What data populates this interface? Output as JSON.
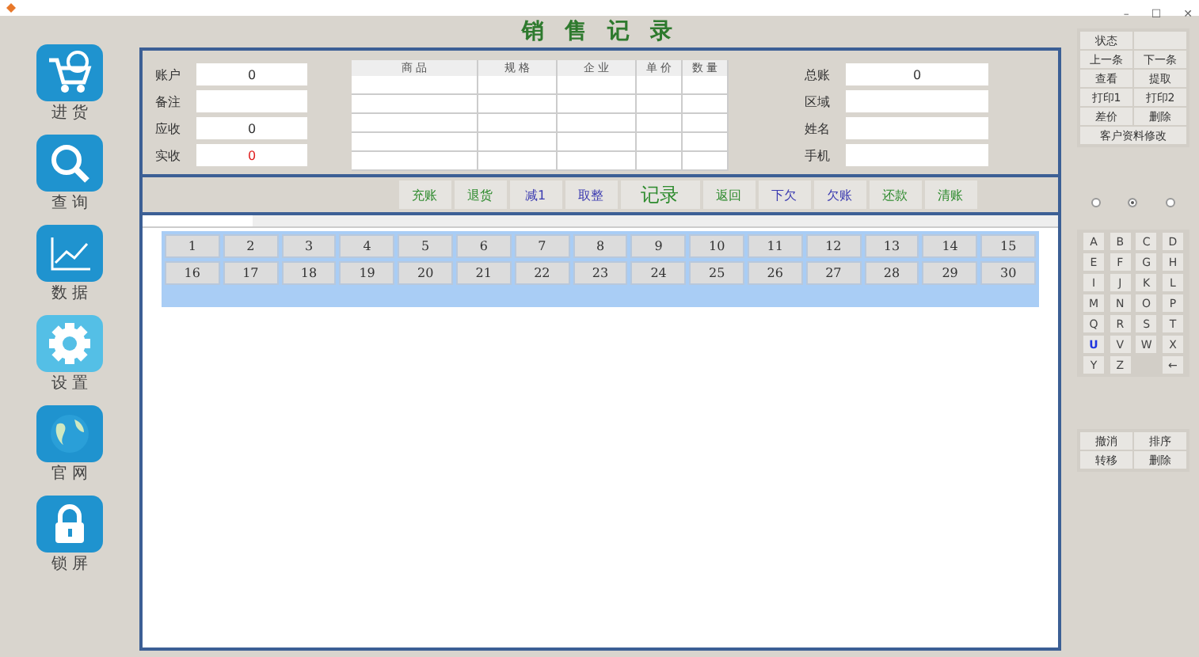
{
  "window": {
    "controls": [
      "–",
      "☐",
      "✕"
    ]
  },
  "title": "销 售 记 录",
  "sidebar": [
    {
      "label": "进 货",
      "kind": "cart"
    },
    {
      "label": "查 询",
      "kind": "search"
    },
    {
      "label": "数 据",
      "kind": "chart"
    },
    {
      "label": "设 置",
      "kind": "gear"
    },
    {
      "label": "官 网",
      "kind": "globe"
    },
    {
      "label": "锁 屏",
      "kind": "lock"
    }
  ],
  "left_fields": [
    {
      "label": "账户",
      "value": "0",
      "alert": false
    },
    {
      "label": "备注"
    },
    {
      "label": "应收",
      "value": "0",
      "alert": false
    },
    {
      "label": "实收",
      "value": "0",
      "alert": true
    }
  ],
  "table": {
    "columns": [
      "商 品",
      "规 格",
      "企 业",
      "单 价",
      "数 量"
    ]
  },
  "right_fields": [
    {
      "label": "总账",
      "value": "0"
    },
    {
      "label": "区域"
    },
    {
      "label": "姓名"
    },
    {
      "label": "手机"
    }
  ],
  "toolbar": [
    {
      "label": "充账",
      "color": "#2e8b2e",
      "big": false
    },
    {
      "label": "退货",
      "color": "#2e8b2e",
      "big": false
    },
    {
      "label": "减1",
      "color": "#3a3ab0",
      "big": false
    },
    {
      "label": "取整",
      "color": "#3a3ab0",
      "big": false
    },
    {
      "label": "记录",
      "color": "#2e8b2e",
      "big": true
    },
    {
      "label": "返回",
      "color": "#2e8b2e",
      "big": false
    },
    {
      "label": "下欠",
      "color": "#3a3ab0",
      "big": false
    },
    {
      "label": "欠账",
      "color": "#3a3ab0",
      "big": false
    },
    {
      "label": "还款",
      "color": "#2e8b2e",
      "big": false
    },
    {
      "label": "清账",
      "color": "#2e8b2e",
      "big": false
    }
  ],
  "numbers": [
    "1",
    "2",
    "3",
    "4",
    "5",
    "6",
    "7",
    "8",
    "9",
    "10",
    "11",
    "12",
    "13",
    "14",
    "15",
    "16",
    "17",
    "18",
    "19",
    "20",
    "21",
    "22",
    "23",
    "24",
    "25",
    "26",
    "27",
    "28",
    "29",
    "30"
  ],
  "side_buttons": [
    {
      "kind": "button",
      "label": "状态"
    },
    {
      "kind": "blank"
    },
    {
      "kind": "button",
      "label": "上一条"
    },
    {
      "kind": "button",
      "label": "下一条"
    },
    {
      "kind": "button",
      "label": "查看"
    },
    {
      "kind": "button",
      "label": "提取"
    },
    {
      "kind": "button",
      "label": "打印1"
    },
    {
      "kind": "button",
      "label": "打印2"
    },
    {
      "kind": "button",
      "label": "差价"
    },
    {
      "kind": "button",
      "label": "删除"
    },
    {
      "kind": "wide",
      "label": "客户资料修改"
    }
  ],
  "radios": [
    {
      "selected": false
    },
    {
      "selected": true
    },
    {
      "selected": false
    }
  ],
  "keys": [
    {
      "label": "A",
      "highlight": false
    },
    {
      "label": "B",
      "highlight": false
    },
    {
      "label": "C",
      "highlight": false
    },
    {
      "label": "D",
      "highlight": false
    },
    {
      "label": "E",
      "highlight": false
    },
    {
      "label": "F",
      "highlight": false
    },
    {
      "label": "G",
      "highlight": false
    },
    {
      "label": "H",
      "highlight": false
    },
    {
      "label": "I",
      "highlight": false
    },
    {
      "label": "J",
      "highlight": false
    },
    {
      "label": "K",
      "highlight": false
    },
    {
      "label": "L",
      "highlight": false
    },
    {
      "label": "M",
      "highlight": false
    },
    {
      "label": "N",
      "highlight": false
    },
    {
      "label": "O",
      "highlight": false
    },
    {
      "label": "P",
      "highlight": false
    },
    {
      "label": "Q",
      "highlight": false
    },
    {
      "label": "R",
      "highlight": false
    },
    {
      "label": "S",
      "highlight": false
    },
    {
      "label": "T",
      "highlight": false
    },
    {
      "label": "U",
      "highlight": true
    },
    {
      "label": "V",
      "highlight": false
    },
    {
      "label": "W",
      "highlight": false
    },
    {
      "label": "X",
      "highlight": false
    },
    {
      "label": "Y",
      "highlight": false
    },
    {
      "label": "Z",
      "highlight": false
    },
    {
      "label": "←",
      "highlight": false,
      "kind": "far"
    }
  ],
  "bottom_buttons": [
    "撤消",
    "排序",
    "转移",
    "删除"
  ]
}
